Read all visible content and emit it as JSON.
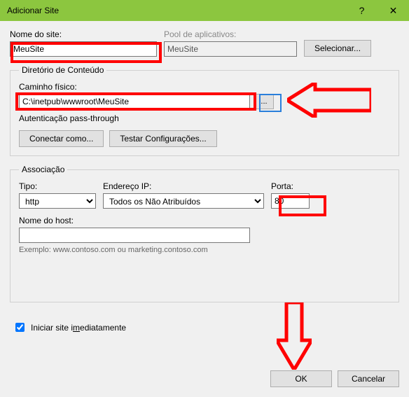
{
  "window": {
    "title": "Adicionar Site",
    "help": "?",
    "close": "✕"
  },
  "labels": {
    "site_name": "Nome do site:",
    "app_pool": "Pool de aplicativos:",
    "select": "Selecionar...",
    "content_dir": "Diretório de Conteúdo",
    "phys_path": "Caminho físico:",
    "browse": "...",
    "auth": "Autenticação pass-through",
    "connect_as": "Conectar como...",
    "test_cfg": "Testar Configurações...",
    "binding": "Associação",
    "type": "Tipo:",
    "ip": "Endereço IP:",
    "port": "Porta:",
    "host": "Nome do host:",
    "example": "Exemplo: www.contoso.com ou marketing.contoso.com",
    "start_now_pre": "Iniciar site i",
    "start_now_u": "m",
    "start_now_post": "ediatamente",
    "ok": "OK",
    "cancel": "Cancelar"
  },
  "values": {
    "site_name": "MeuSite",
    "app_pool": "MeuSite",
    "phys_path": "C:\\inetpub\\wwwroot\\MeuSite",
    "type": "http",
    "ip": "Todos os Não Atribuídos",
    "port": "80",
    "host": "",
    "start_now": true
  }
}
